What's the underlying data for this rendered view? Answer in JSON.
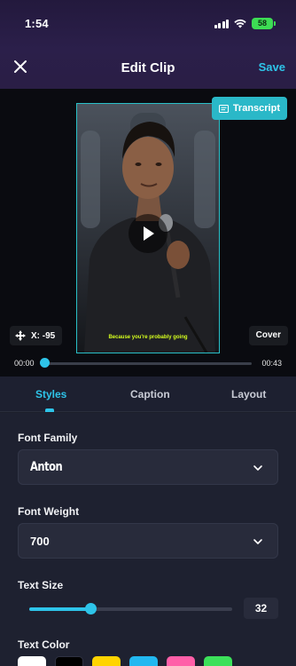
{
  "status_bar": {
    "time": "1:54",
    "battery": "58"
  },
  "nav": {
    "title": "Edit Clip",
    "save_label": "Save"
  },
  "video": {
    "transcript_label": "Transcript",
    "subtitle_text": "Because you're probably going",
    "position_label": "X: -95",
    "cover_label": "Cover",
    "time_start": "00:00",
    "time_end": "00:43",
    "progress_fraction": 0.0
  },
  "tabs": [
    {
      "label": "Styles",
      "active": true
    },
    {
      "label": "Caption",
      "active": false
    },
    {
      "label": "Layout",
      "active": false
    }
  ],
  "styles": {
    "font_family_label": "Font Family",
    "font_family_value": "Anton",
    "font_weight_label": "Font Weight",
    "font_weight_value": "700",
    "text_size_label": "Text Size",
    "text_size_value": "32",
    "text_size_fraction": 0.3,
    "text_color_label": "Text Color",
    "colors": [
      "#ffffff",
      "#000000",
      "#ffd400",
      "#22b8f0",
      "#ff5fa8",
      "#3ce05a"
    ]
  },
  "accent_color": "#2ec4e9"
}
